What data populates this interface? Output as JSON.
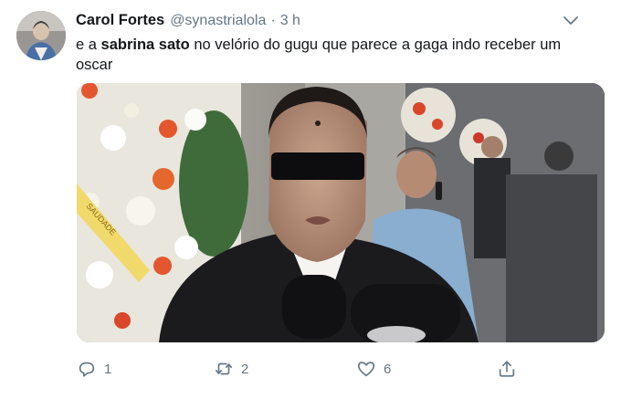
{
  "tweet": {
    "author": {
      "display_name": "Carol Fortes",
      "handle": "@synastrialola",
      "avatar_icon": "avatar-photo"
    },
    "separator": "·",
    "time": "3 h",
    "menu_icon": "chevron-down-icon",
    "text": {
      "before": "e a ",
      "mention": "sabrina sato",
      "after": " no velório do gugu que parece a gaga indo receber um oscar"
    },
    "media": {
      "description_icon": "video-frame",
      "ribbon_text": "SAUDADE"
    },
    "actions": {
      "reply": {
        "icon": "reply-icon",
        "count": "1"
      },
      "retweet": {
        "icon": "retweet-icon",
        "count": "2"
      },
      "like": {
        "icon": "heart-icon",
        "count": "6"
      },
      "share": {
        "icon": "share-icon"
      }
    },
    "colors": {
      "text": "#14171a",
      "secondary": "#657786",
      "background": "#ffffff"
    }
  }
}
